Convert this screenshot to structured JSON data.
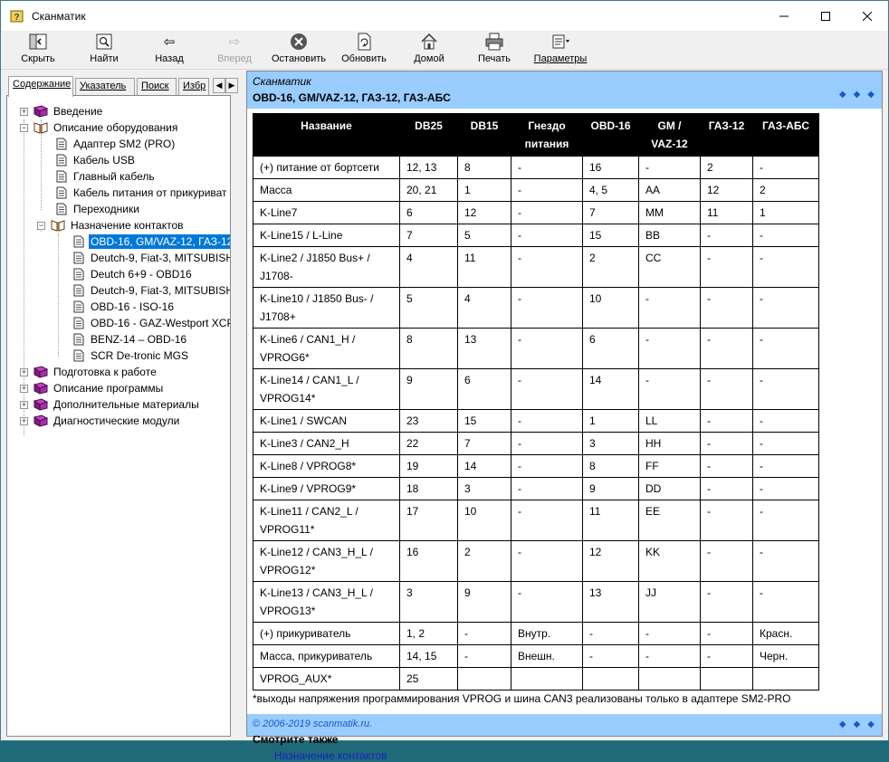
{
  "window": {
    "title": "Сканматик"
  },
  "toolbar": {
    "hide": "Скрыть",
    "find": "Найти",
    "back": "Назад",
    "forward": "Вперед",
    "stop": "Остановить",
    "refresh": "Обновить",
    "home": "Домой",
    "print": "Печать",
    "options": "Параметры"
  },
  "tabs": {
    "contents": "Содержание",
    "index": "Указатель",
    "search": "Поиск",
    "favorites": "Избр"
  },
  "tree": {
    "intro": "Введение",
    "equipment": "Описание оборудования",
    "adapter": "Адаптер SM2 (PRO)",
    "usb_cable": "Кабель USB",
    "main_cable": "Главный кабель",
    "power_cable": "Кабель питания от прикуриват",
    "adapters": "Переходники",
    "pin_assignment": "Назначение контактов",
    "pin_items": [
      "OBD-16, GM/VAZ-12, ГАЗ-12",
      "Deutch-9, Fiat-3, MITSUBISH",
      "Deutch 6+9 - OBD16",
      "Deutch-9, Fiat-3, MITSUBISH",
      "OBD-16 - ISO-16",
      "OBD-16 - GAZ-Westport XCP",
      "BENZ-14 – OBD-16",
      "SCR De-tronic MGS"
    ],
    "preparation": "Подготовка к работе",
    "program": "Описание программы",
    "extra": "Дополнительные материалы",
    "diag": "Диагностические модули"
  },
  "topic": {
    "subtitle": "Сканматик",
    "title": "OBD-16, GM/VAZ-12, ГАЗ-12, ГАЗ-АБС",
    "columns": [
      "Название",
      "DB25",
      "DB15",
      "Гнездо питания",
      "OBD-16",
      "GM / VAZ-12",
      "ГАЗ-12",
      "ГАЗ-АБС"
    ],
    "rows": [
      [
        "(+) питание от бортсети",
        "12, 13",
        "8",
        "-",
        "16",
        "-",
        "2",
        "-"
      ],
      [
        "Масса",
        "20, 21",
        "1",
        "-",
        "4, 5",
        "AA",
        "12",
        "2"
      ],
      [
        "K-Line7",
        "6",
        "12",
        "-",
        "7",
        "MM",
        "11",
        "1"
      ],
      [
        "K-Line15 / L-Line",
        "7",
        "5",
        "-",
        "15",
        "BB",
        "-",
        "-"
      ],
      [
        "K-Line2 / J1850 Bus+ / J1708-",
        "4",
        "11",
        "-",
        "2",
        "CC",
        "-",
        "-"
      ],
      [
        "K-Line10 / J1850 Bus- / J1708+",
        "5",
        "4",
        "-",
        "10",
        "-",
        "-",
        "-"
      ],
      [
        "K-Line6 / CAN1_H / VPROG6*",
        "8",
        "13",
        "-",
        "6",
        "-",
        "-",
        "-"
      ],
      [
        "K-Line14 / CAN1_L / VPROG14*",
        "9",
        "6",
        "-",
        "14",
        "-",
        "-",
        "-"
      ],
      [
        "K-Line1 / SWCAN",
        "23",
        "15",
        "-",
        "1",
        "LL",
        "-",
        "-"
      ],
      [
        "K-Line3 / CAN2_H",
        "22",
        "7",
        "-",
        "3",
        "HH",
        "-",
        "-"
      ],
      [
        "K-Line8 / VPROG8*",
        "19",
        "14",
        "-",
        "8",
        "FF",
        "-",
        "-"
      ],
      [
        "K-Line9 / VPROG9*",
        "18",
        "3",
        "-",
        "9",
        "DD",
        "-",
        "-"
      ],
      [
        "K-Line11 / CAN2_L / VPROG11*",
        "17",
        "10",
        "-",
        "11",
        "EE",
        "-",
        "-"
      ],
      [
        "K-Line12 / CAN3_H_L / VPROG12*",
        "16",
        "2",
        "-",
        "12",
        "KK",
        "-",
        "-"
      ],
      [
        "K-Line13 / CAN3_H_L / VPROG13*",
        "3",
        "9",
        "-",
        "13",
        "JJ",
        "-",
        "-"
      ],
      [
        "(+) прикуриватель",
        "1, 2",
        "-",
        "Внутр.",
        "-",
        "-",
        "-",
        "Красн."
      ],
      [
        "Масса, прикуриватель",
        "14, 15",
        "-",
        "Внешн.",
        "-",
        "-",
        "-",
        "Черн."
      ],
      [
        "VPROG_AUX*",
        "25",
        "",
        "",
        "",
        "",
        "",
        ""
      ]
    ],
    "note": "*выходы напряжения программирования VPROG и шина CAN3 реализованы только в адаптере SM2-PRO",
    "see_also_title": "Смотрите также",
    "see_also_link": "Назначение контактов",
    "copyright": "© 2006-2019 scanmatik.ru."
  }
}
